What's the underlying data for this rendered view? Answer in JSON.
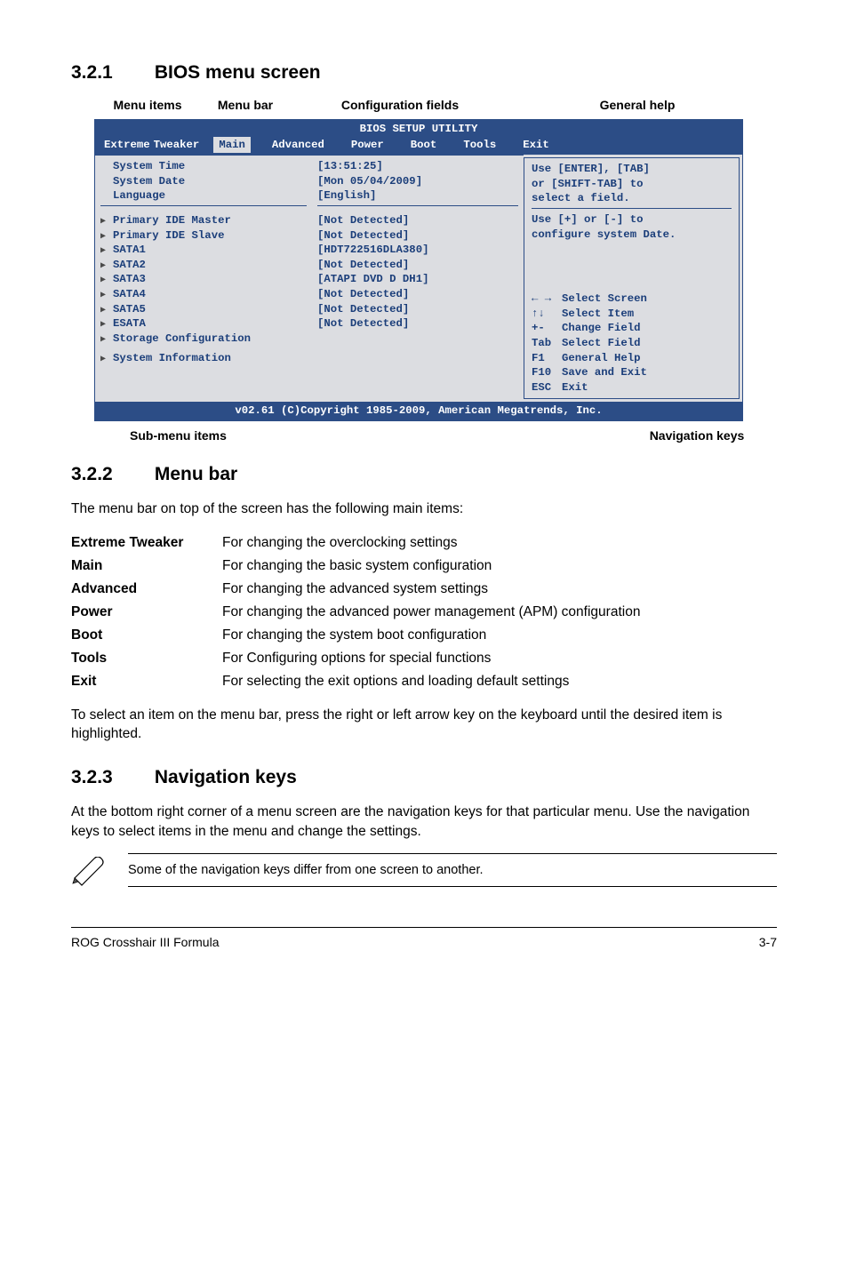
{
  "section_321": {
    "num": "3.2.1",
    "title": "BIOS menu screen"
  },
  "anno": {
    "menu_items": "Menu items",
    "menu_bar": "Menu bar",
    "config_fields": "Configuration fields",
    "general_help": "General help",
    "submenu": "Sub-menu items",
    "navkeys": "Navigation keys"
  },
  "bios": {
    "title": "BIOS SETUP UTILITY",
    "tabs": {
      "extreme": "Extreme",
      "tweaker": "Tweaker",
      "main": "Main",
      "advanced": "Advanced",
      "power": "Power",
      "boot": "Boot",
      "tools": "Tools",
      "exit": "Exit"
    },
    "left": {
      "sys_time": "System Time",
      "sys_date": "System Date",
      "language": "Language",
      "pim": "Primary IDE Master",
      "pis": "Primary IDE Slave",
      "s1": "SATA1",
      "s2": "SATA2",
      "s3": "SATA3",
      "s4": "SATA4",
      "s5": "SATA5",
      "esata": "ESATA",
      "storage": "Storage Configuration",
      "sysinfo": "System Information"
    },
    "mid": {
      "time": "[13:51:25]",
      "date": "[Mon 05/04/2009]",
      "lang": "[English]",
      "nd1": "[Not Detected]",
      "nd2": "[Not Detected]",
      "hdt": "[HDT722516DLA380]",
      "nd3": "[Not Detected]",
      "atapi": "[ATAPI DVD D DH1]",
      "nd4": "[Not Detected]",
      "nd5": "[Not Detected]",
      "nd6": "[Not Detected]"
    },
    "help": {
      "l1": "Use [ENTER], [TAB]",
      "l2": "or [SHIFT-TAB] to",
      "l3": "select a field.",
      "l4": "Use [+] or [-] to",
      "l5": "configure system Date."
    },
    "nav": {
      "n1a": "← →",
      "n1b": "Select Screen",
      "n2a": "↑↓",
      "n2b": "Select Item",
      "n3a": "+-",
      "n3b": "Change Field",
      "n4a": "Tab",
      "n4b": "Select Field",
      "n5a": "F1",
      "n5b": "General Help",
      "n6a": "F10",
      "n6b": "Save and Exit",
      "n7a": "ESC",
      "n7b": "Exit"
    },
    "footer": "v02.61 (C)Copyright 1985-2009, American Megatrends, Inc."
  },
  "section_322": {
    "num": "3.2.2",
    "title": "Menu bar"
  },
  "menubar_intro": "The menu bar on top of the screen has the following main items:",
  "defs": {
    "extreme_tweaker": {
      "term": "Extreme Tweaker",
      "desc": "For changing the overclocking settings"
    },
    "main": {
      "term": "Main",
      "desc": "For changing the basic system configuration"
    },
    "advanced": {
      "term": "Advanced",
      "desc": "For changing the advanced system settings"
    },
    "power": {
      "term": "Power",
      "desc": "For changing the advanced power management (APM) configuration"
    },
    "boot": {
      "term": "Boot",
      "desc": "For changing the system boot configuration"
    },
    "tools": {
      "term": "Tools",
      "desc": "For Configuring options for special functions"
    },
    "exit": {
      "term": "Exit",
      "desc": "For selecting the exit options and loading default settings"
    }
  },
  "menubar_outro": "To select an item on the menu bar, press the right or left arrow key on the keyboard until the desired item is highlighted.",
  "section_323": {
    "num": "3.2.3",
    "title": "Navigation keys"
  },
  "navkeys_text": "At the bottom right corner of a menu screen are the navigation keys for that particular menu. Use the navigation keys to select items in the menu and change the settings.",
  "note_text": "Some of the navigation keys differ from one screen to another.",
  "footer": {
    "left": "ROG Crosshair III Formula",
    "right": "3-7"
  }
}
